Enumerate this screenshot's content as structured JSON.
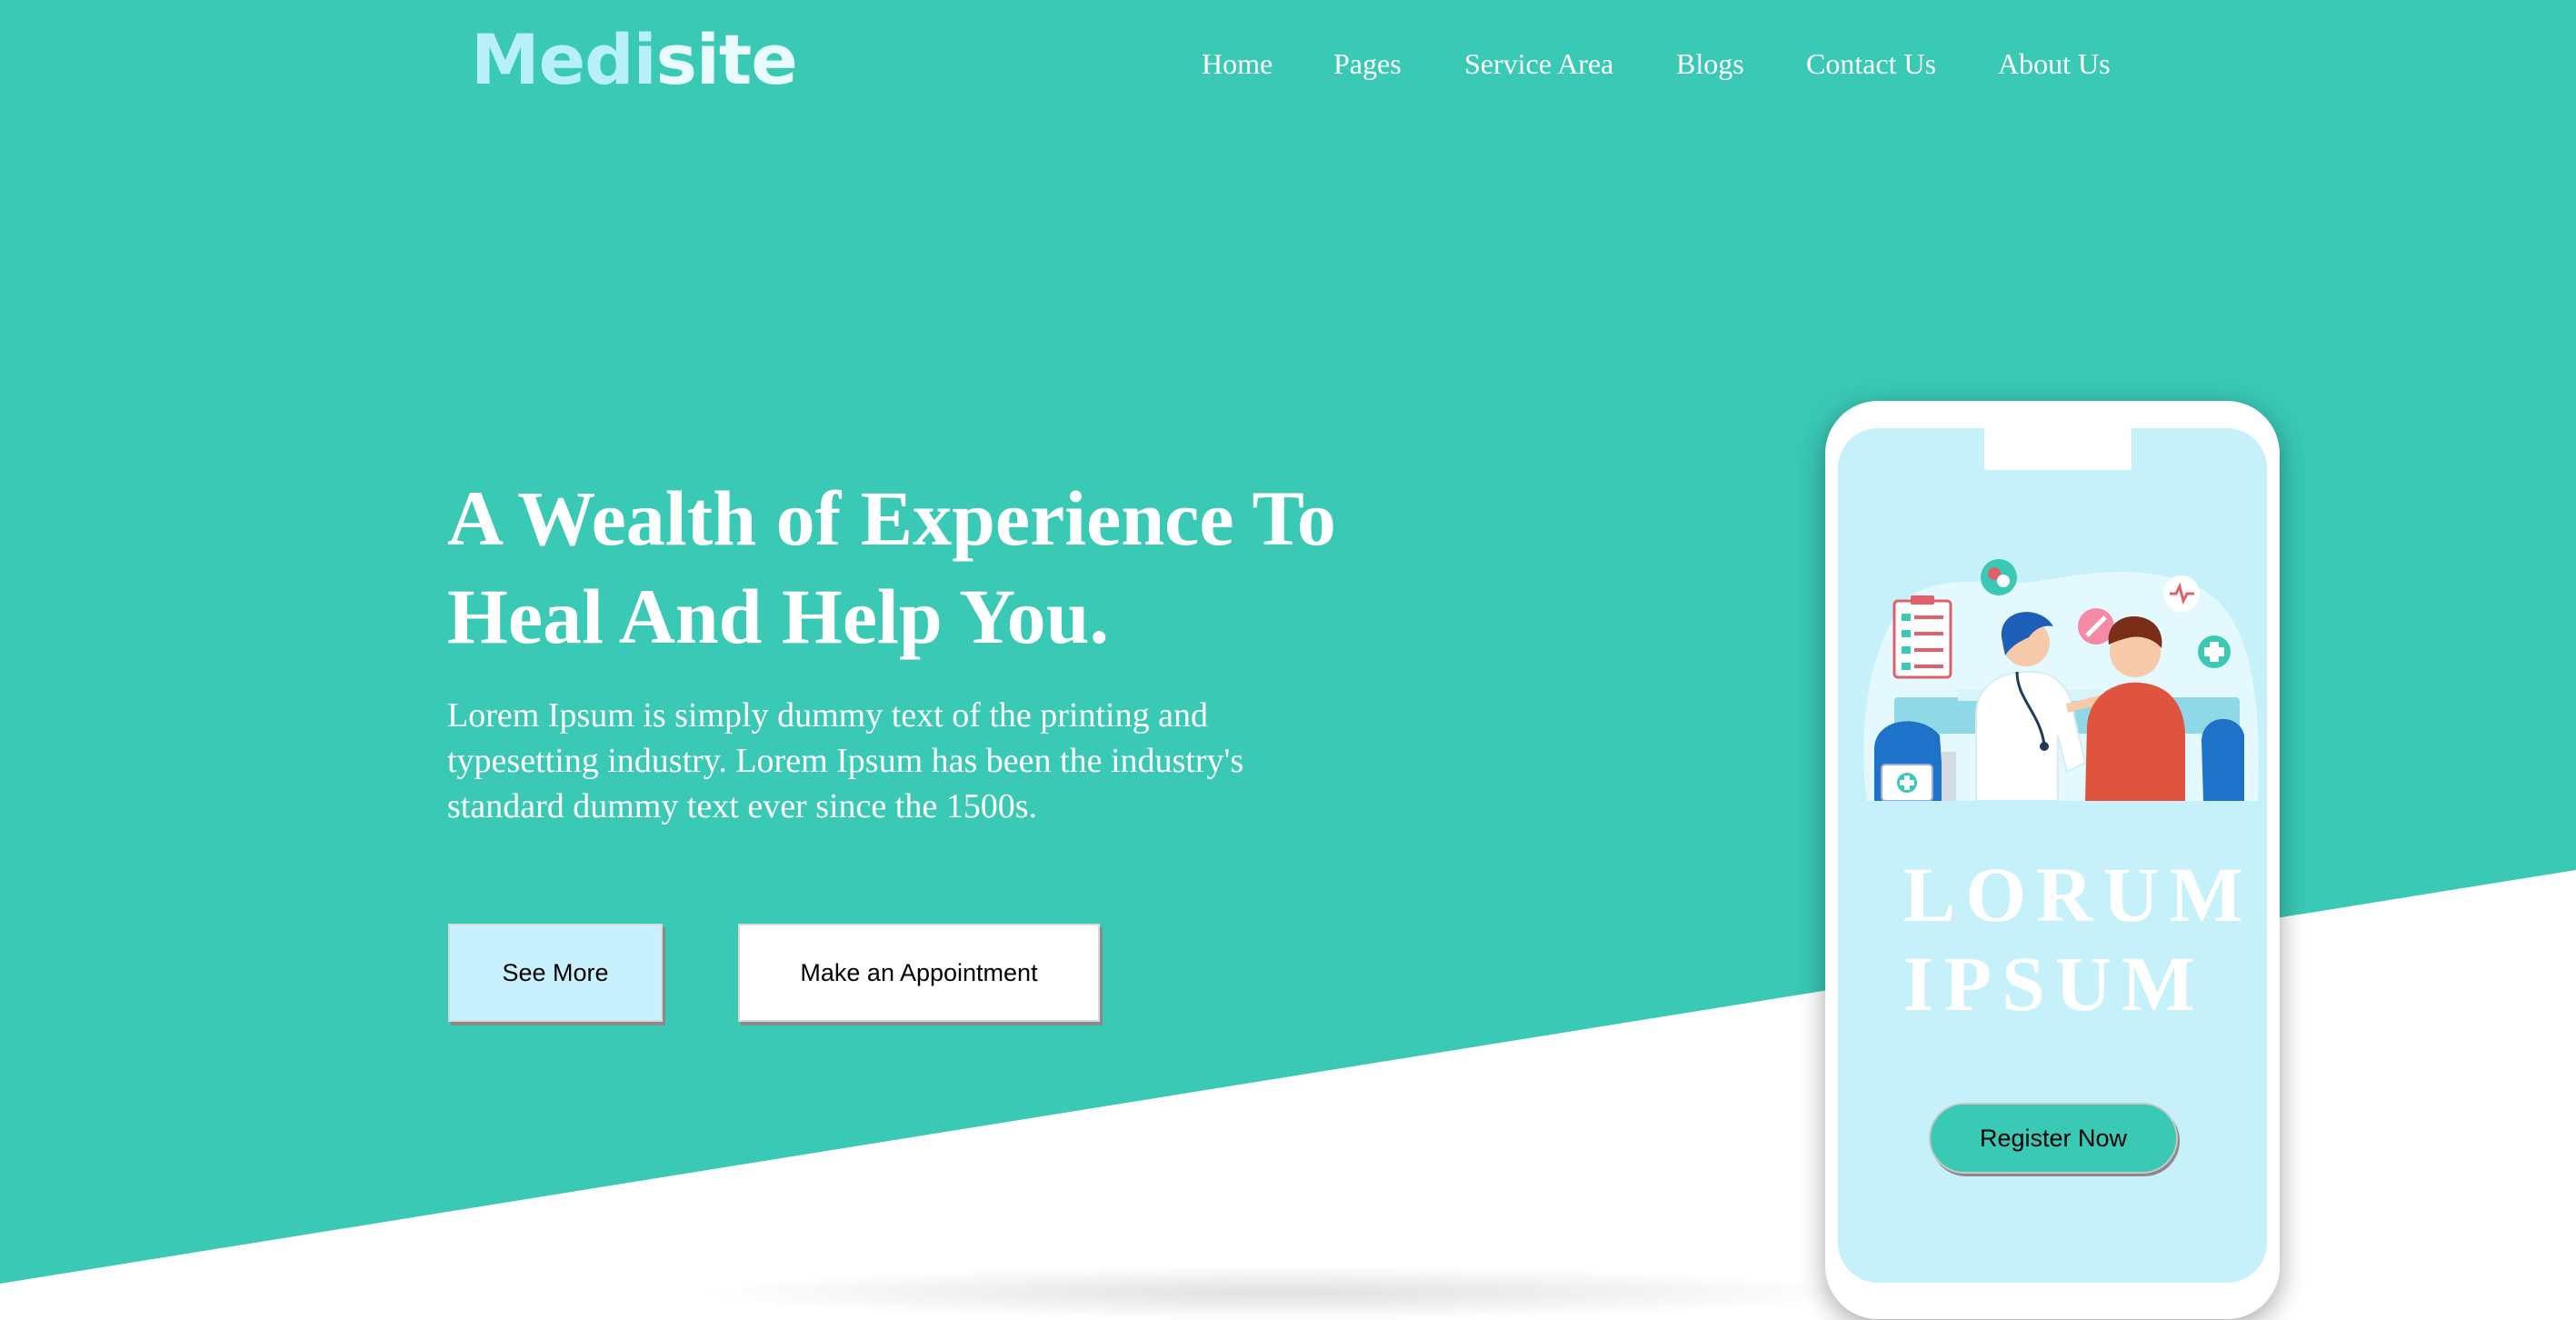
{
  "header": {
    "logo_part1": "Medi",
    "logo_part2": "site",
    "nav": [
      {
        "label": "Home"
      },
      {
        "label": "Pages"
      },
      {
        "label": "Service Area"
      },
      {
        "label": "Blogs"
      },
      {
        "label": "Contact Us"
      },
      {
        "label": "About Us"
      }
    ]
  },
  "hero": {
    "headline_line1": "A Wealth of Experience To",
    "headline_line2": "Heal And Help You.",
    "paragraph": "Lorem Ipsum is simply dummy text of the printing and typesetting industry. Lorem Ipsum has been the industry's standard dummy text ever since the 1500s.",
    "see_more_label": "See More",
    "appointment_label": "Make an Appointment"
  },
  "phone": {
    "title_line1": "LORUM",
    "title_line2": "IPSUM",
    "register_label": "Register Now",
    "illustration": "doctor-patient-illustration"
  },
  "colors": {
    "accent": "#39c9b5",
    "logo_light": "#b7f0f7",
    "phone_screen": "#c6f1fb",
    "see_more_bg": "#c7f1fc"
  }
}
